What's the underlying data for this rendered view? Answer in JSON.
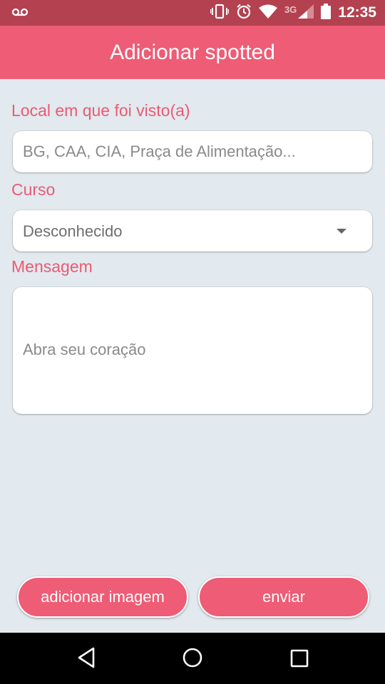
{
  "status_bar": {
    "time": "12:35",
    "network": "3G",
    "icons": [
      "voicemail-icon",
      "vibrate-icon",
      "alarm-icon",
      "wifi-icon",
      "signal-icon",
      "battery-icon"
    ]
  },
  "app_bar": {
    "title": "Adicionar spotted"
  },
  "form": {
    "location": {
      "label": "Local em que foi visto(a)",
      "placeholder": "BG, CAA, CIA, Praça de Alimentação..."
    },
    "course": {
      "label": "Curso",
      "selected": "Desconhecido"
    },
    "message": {
      "label": "Mensagem",
      "placeholder": "Abra seu coração"
    }
  },
  "buttons": {
    "add_image": "adicionar imagem",
    "send": "enviar"
  },
  "colors": {
    "primary": "#ee5c75",
    "status_bar": "#b3414f",
    "background": "#e2e9ef",
    "label": "#ec5a72"
  },
  "nav_bar": {
    "icons": [
      "back-icon",
      "home-icon",
      "recents-icon"
    ]
  }
}
